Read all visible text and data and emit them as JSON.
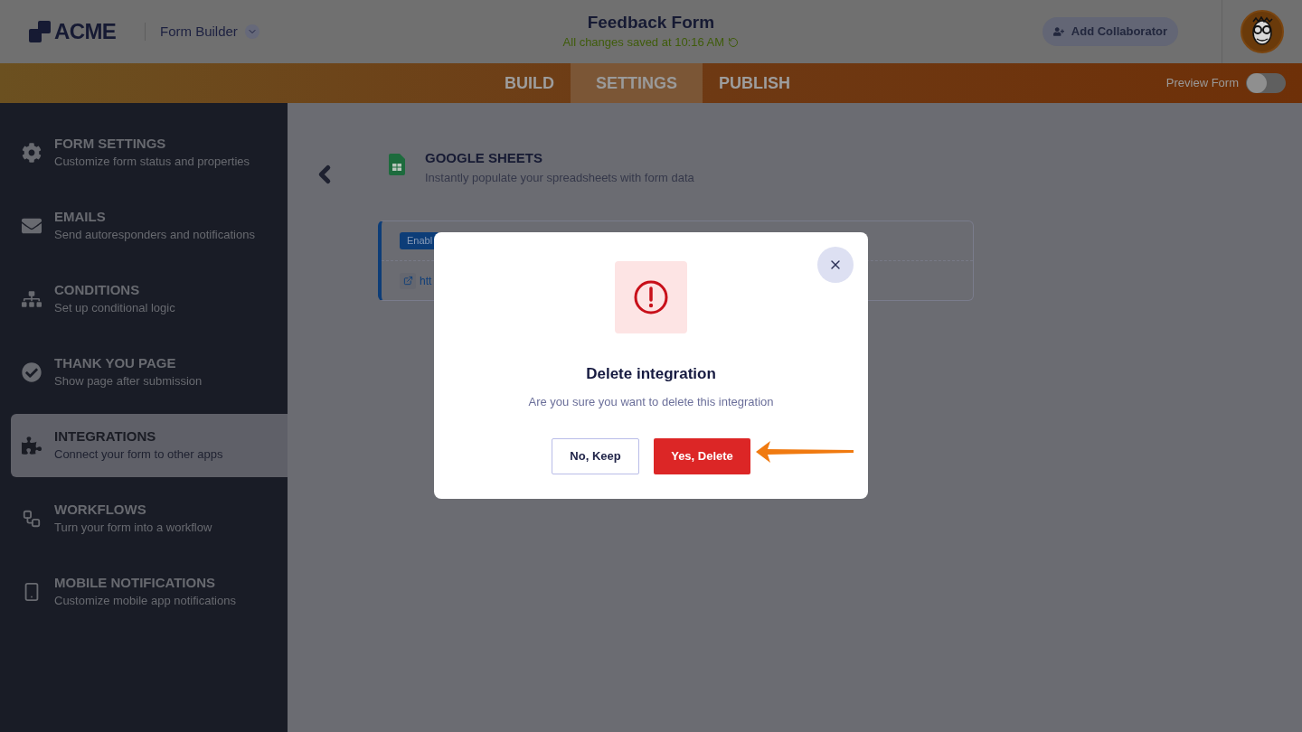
{
  "header": {
    "logo": "ACME",
    "app_menu": "Form Builder",
    "form_title": "Feedback Form",
    "save_status": "All changes saved at 10:16 AM",
    "collaborator_button": "Add Collaborator"
  },
  "tabs": [
    {
      "label": "BUILD",
      "selected": false
    },
    {
      "label": "SETTINGS",
      "selected": true
    },
    {
      "label": "PUBLISH",
      "selected": false
    }
  ],
  "preview": {
    "label": "Preview Form",
    "on": false
  },
  "sidebar": {
    "items": [
      {
        "kind": "gear",
        "title": "FORM SETTINGS",
        "subtitle": "Customize form status and properties",
        "selected": false
      },
      {
        "kind": "mail",
        "title": "EMAILS",
        "subtitle": "Send autoresponders and notifications",
        "selected": false
      },
      {
        "kind": "tree",
        "title": "CONDITIONS",
        "subtitle": "Set up conditional logic",
        "selected": false
      },
      {
        "kind": "check",
        "title": "THANK YOU PAGE",
        "subtitle": "Show page after submission",
        "selected": false
      },
      {
        "kind": "puzzle",
        "title": "INTEGRATIONS",
        "subtitle": "Connect your form to other apps",
        "selected": true
      },
      {
        "kind": "flow",
        "title": "WORKFLOWS",
        "subtitle": "Turn your form into a workflow",
        "selected": false
      },
      {
        "kind": "phone",
        "title": "MOBILE NOTIFICATIONS",
        "subtitle": "Customize mobile app notifications",
        "selected": false
      }
    ]
  },
  "integration": {
    "title": "GOOGLE SHEETS",
    "description": "Instantly populate your spreadsheets with form data",
    "status_badge": "Enabl",
    "link": "htt"
  },
  "dialog": {
    "title": "Delete integration",
    "message": "Are you sure you want to delete this integration",
    "buttons": [
      {
        "label": "No, Keep",
        "kind": "secondary"
      },
      {
        "label": "Yes, Delete",
        "kind": "danger"
      }
    ]
  }
}
